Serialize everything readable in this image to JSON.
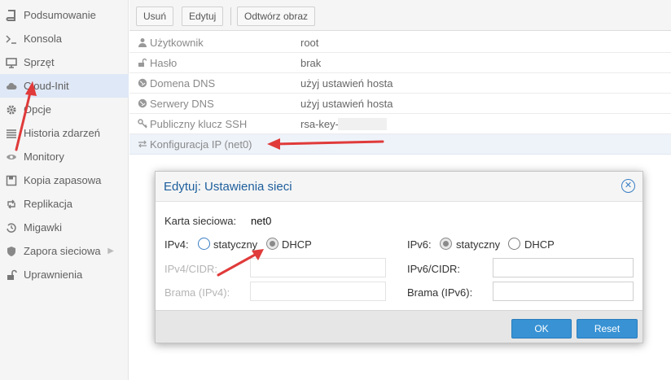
{
  "sidebar": {
    "items": [
      {
        "label": "Podsumowanie",
        "icon": "book-icon"
      },
      {
        "label": "Konsola",
        "icon": "terminal-icon"
      },
      {
        "label": "Sprzęt",
        "icon": "monitor-icon"
      },
      {
        "label": "Cloud-Init",
        "icon": "cloud-icon",
        "active": true
      },
      {
        "label": "Opcje",
        "icon": "gear-icon"
      },
      {
        "label": "Historia zdarzeń",
        "icon": "list-icon"
      },
      {
        "label": "Monitory",
        "icon": "eye-icon"
      },
      {
        "label": "Kopia zapasowa",
        "icon": "floppy-icon"
      },
      {
        "label": "Replikacja",
        "icon": "retweet-icon"
      },
      {
        "label": "Migawki",
        "icon": "history-icon"
      },
      {
        "label": "Zapora sieciowa",
        "icon": "shield-icon"
      },
      {
        "label": "Uprawnienia",
        "icon": "unlock-icon"
      }
    ]
  },
  "toolbar": {
    "remove": "Usuń",
    "edit": "Edytuj",
    "regenerate": "Odtwórz obraz"
  },
  "rows": [
    {
      "label": "Użytkownik",
      "value": "root",
      "icon": "user-icon"
    },
    {
      "label": "Hasło",
      "value": "brak",
      "icon": "unlock-icon"
    },
    {
      "label": "Domena DNS",
      "value": "użyj ustawień hosta",
      "icon": "globe-icon"
    },
    {
      "label": "Serwery DNS",
      "value": "użyj ustawień hosta",
      "icon": "globe-icon"
    },
    {
      "label": "Publiczny klucz SSH",
      "value": "rsa-key-",
      "icon": "key-icon"
    },
    {
      "label": "Konfiguracja IP (net0)",
      "value": "",
      "icon": "exchange-icon"
    }
  ],
  "dialog": {
    "title": "Edytuj: Ustawienia sieci",
    "nic_label": "Karta sieciowa:",
    "nic_value": "net0",
    "ipv4_label": "IPv4:",
    "ipv6_label": "IPv6:",
    "static_label": "statyczny",
    "dhcp_label": "DHCP",
    "ipv4_mode": "DHCP",
    "ipv6_mode": "statyczny",
    "ipv4_cidr_label": "IPv4/CIDR:",
    "ipv4_gw_label": "Brama (IPv4):",
    "ipv6_cidr_label": "IPv6/CIDR:",
    "ipv6_gw_label": "Brama (IPv6):",
    "ipv4_cidr_value": "",
    "ipv4_gw_value": "",
    "ipv6_cidr_value": "",
    "ipv6_gw_value": "",
    "ok_label": "OK",
    "reset_label": "Reset"
  },
  "colors": {
    "accent": "#3892d4",
    "title": "#1d5e9c",
    "arrow": "#e03a3a"
  }
}
